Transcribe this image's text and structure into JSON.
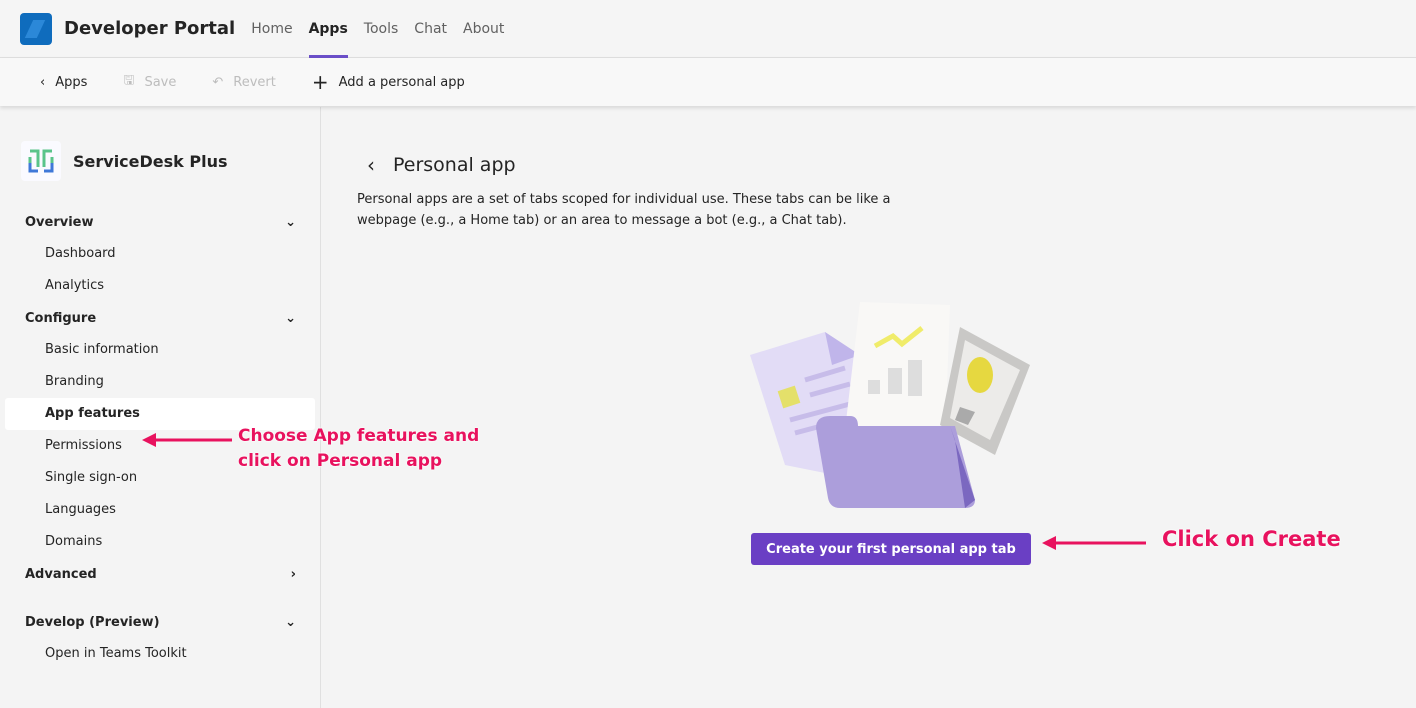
{
  "header": {
    "title": "Developer Portal",
    "nav": [
      "Home",
      "Apps",
      "Tools",
      "Chat",
      "About"
    ],
    "active": "Apps"
  },
  "toolbar": {
    "back": "Apps",
    "save": "Save",
    "revert": "Revert",
    "add": "Add a personal app"
  },
  "sidebar": {
    "app_name": "ServiceDesk Plus",
    "overview": {
      "label": "Overview",
      "items": [
        "Dashboard",
        "Analytics"
      ]
    },
    "configure": {
      "label": "Configure",
      "items": [
        "Basic information",
        "Branding",
        "App features",
        "Permissions",
        "Single sign-on",
        "Languages",
        "Domains"
      ]
    },
    "advanced": {
      "label": "Advanced"
    },
    "develop": {
      "label": "Develop (Preview)",
      "items": [
        "Open in Teams Toolkit"
      ]
    }
  },
  "main": {
    "title": "Personal app",
    "description": "Personal apps are a set of tabs scoped for individual use. These tabs can be like a webpage (e.g., a Home tab) or an area to message a bot (e.g., a Chat tab).",
    "create_button": "Create your first personal app tab"
  },
  "annotations": {
    "features_line1": "Choose App features and",
    "features_line2": "click on Personal app",
    "create": "Click on Create"
  }
}
